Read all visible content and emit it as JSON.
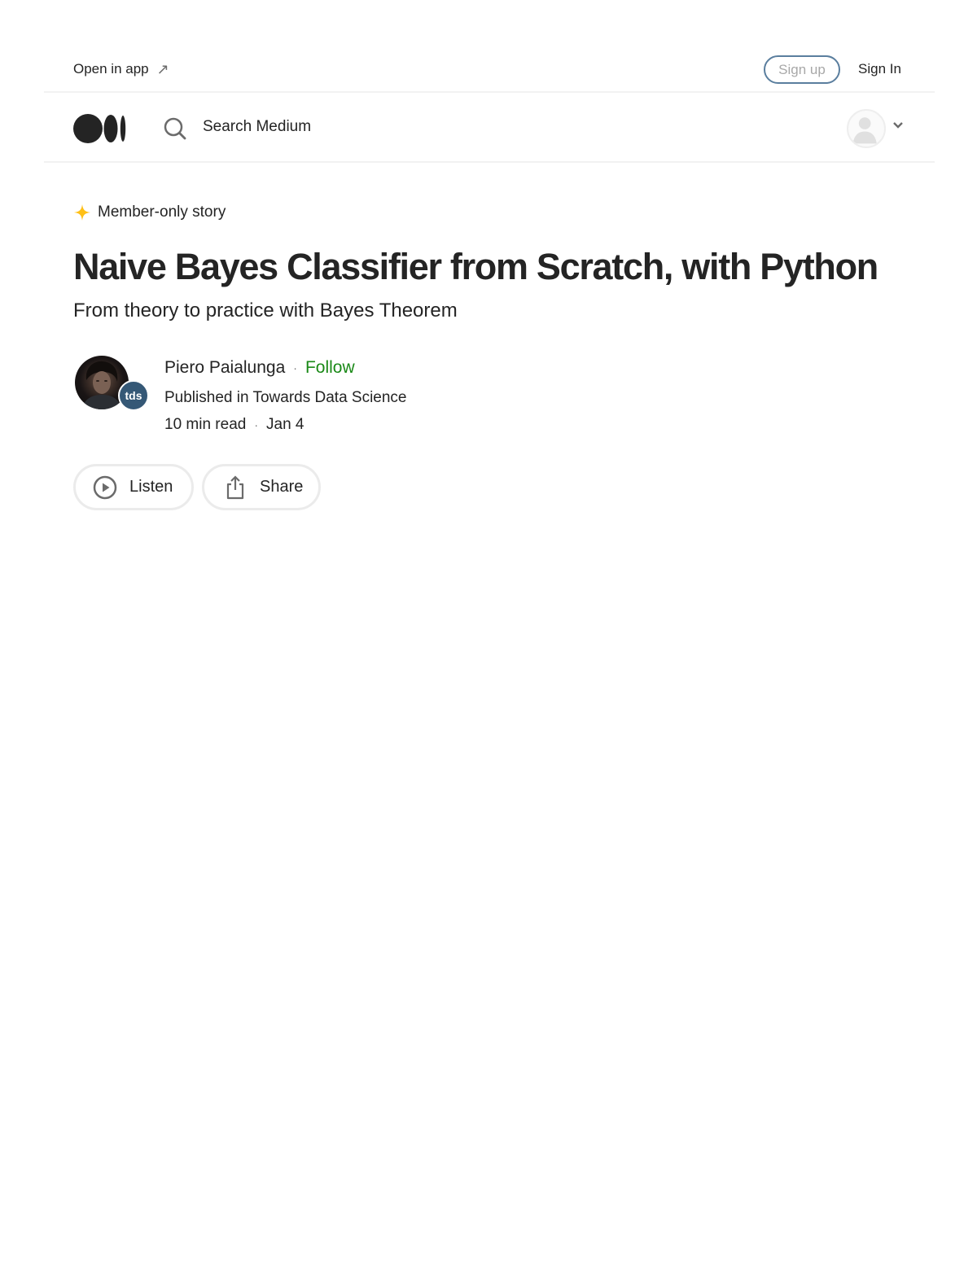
{
  "topbar": {
    "open_in_app": "Open in app",
    "open_in_app_icon": "arrow-up-right-icon",
    "sign_up": "Sign up",
    "sign_in": "Sign In"
  },
  "navbar": {
    "logo": "medium-logo",
    "search_icon": "search-icon",
    "search_label": "Search Medium",
    "avatar_icon": "anonymous-user-icon",
    "menu_icon": "chevron-down-icon"
  },
  "article": {
    "member_badge": "Member-only story",
    "member_icon": "star-icon",
    "title": "Naive Bayes Classifier from Scratch, with Python",
    "subtitle": "From theory to practice with Bayes Theorem",
    "author": {
      "name": "Piero Paialunga",
      "follow": "Follow",
      "separator": "·"
    },
    "publication": {
      "prefix": "Published in",
      "name": "Towards Data Science",
      "badge": "tds"
    },
    "meta": {
      "read_time": "10 min read",
      "separator": "·",
      "date": "Jan 4"
    },
    "actions": {
      "listen": "Listen",
      "share": "Share"
    }
  },
  "colors": {
    "text": "#242424",
    "follow_green": "#1a8917",
    "star_yellow": "#ffc017",
    "signup_border": "#5a7e9e",
    "pub_badge": "#355876",
    "divider": "#f2f2f2"
  }
}
